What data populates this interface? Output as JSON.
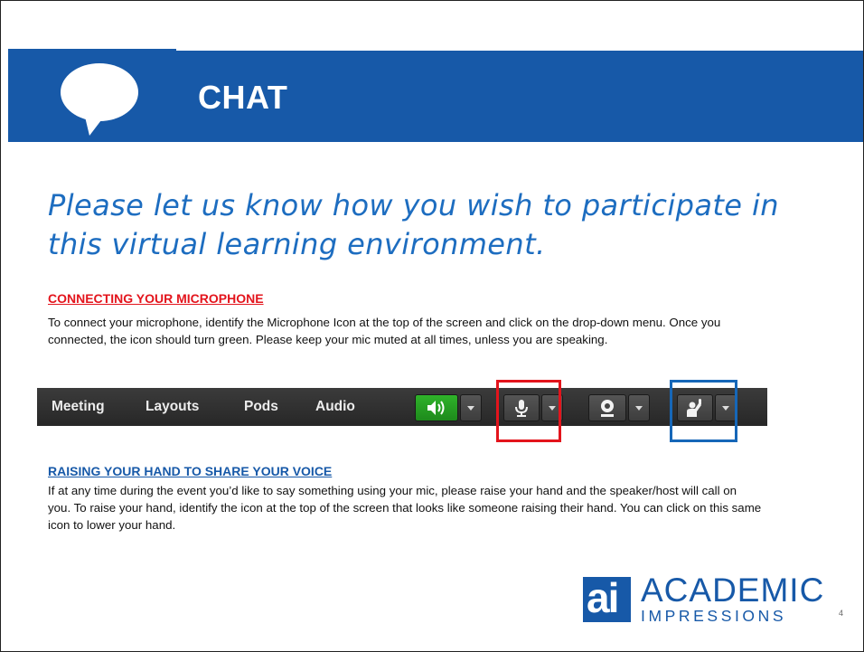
{
  "slide": {
    "banner_title": "CHAT",
    "headline": "Please let us know how you wish to participate in this virtual learning environment.",
    "page_number": "4"
  },
  "mic_section": {
    "heading": "CONNECTING YOUR MICROPHONE",
    "body": "To connect your microphone, identify the Microphone Icon at the top of the screen and click on the drop-down menu. Once you connected, the icon should turn green.  Please keep your mic muted at all times, unless you are speaking."
  },
  "toolbar": {
    "menu": [
      "Meeting",
      "Layouts",
      "Pods",
      "Audio"
    ],
    "buttons": [
      {
        "icon": "speaker-icon",
        "state": "active",
        "color": "#22a020"
      },
      {
        "icon": "microphone-icon"
      },
      {
        "icon": "webcam-icon"
      },
      {
        "icon": "raise-hand-icon"
      }
    ]
  },
  "hand_section": {
    "heading": "RAISING YOUR HAND TO SHARE YOUR VOICE",
    "body": "If at any time during the event you’d like to say something using your mic, please raise your hand and the speaker/host will call on you.  To raise your hand, identify the icon at the top of the screen that looks like someone raising their hand.  You can click on this same icon to lower your hand."
  },
  "logo": {
    "mark": "ai",
    "word_top": "ACADEMIC",
    "word_bottom": "IMPRESSIONS"
  },
  "colors": {
    "brand_blue": "#1759a8",
    "headline_blue": "#1d6dc0",
    "highlight_red": "#e3141c",
    "highlight_blue": "#1667b8"
  }
}
